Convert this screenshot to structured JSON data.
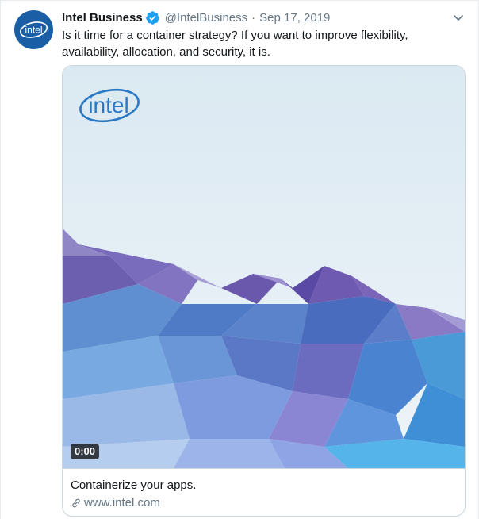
{
  "tweet": {
    "display_name": "Intel Business",
    "handle": "@IntelBusiness",
    "separator": "·",
    "date": "Sep 17, 2019",
    "text": "Is it time for a container strategy? If you want to improve flexibility, availability, allocation, and security, it is.",
    "avatar_logo_text": "intel",
    "verified_icon": "verified-badge-icon",
    "menu_icon": "chevron-down-icon"
  },
  "card": {
    "media_logo_text": "intel",
    "video_duration": "0:00",
    "title": "Containerize your apps.",
    "url": "www.intel.com",
    "link_icon": "link-icon"
  },
  "colors": {
    "brand_blue": "#1a5ea6",
    "verified_blue": "#1da1f2",
    "muted_text": "#657786",
    "border": "#ccd6dd"
  }
}
